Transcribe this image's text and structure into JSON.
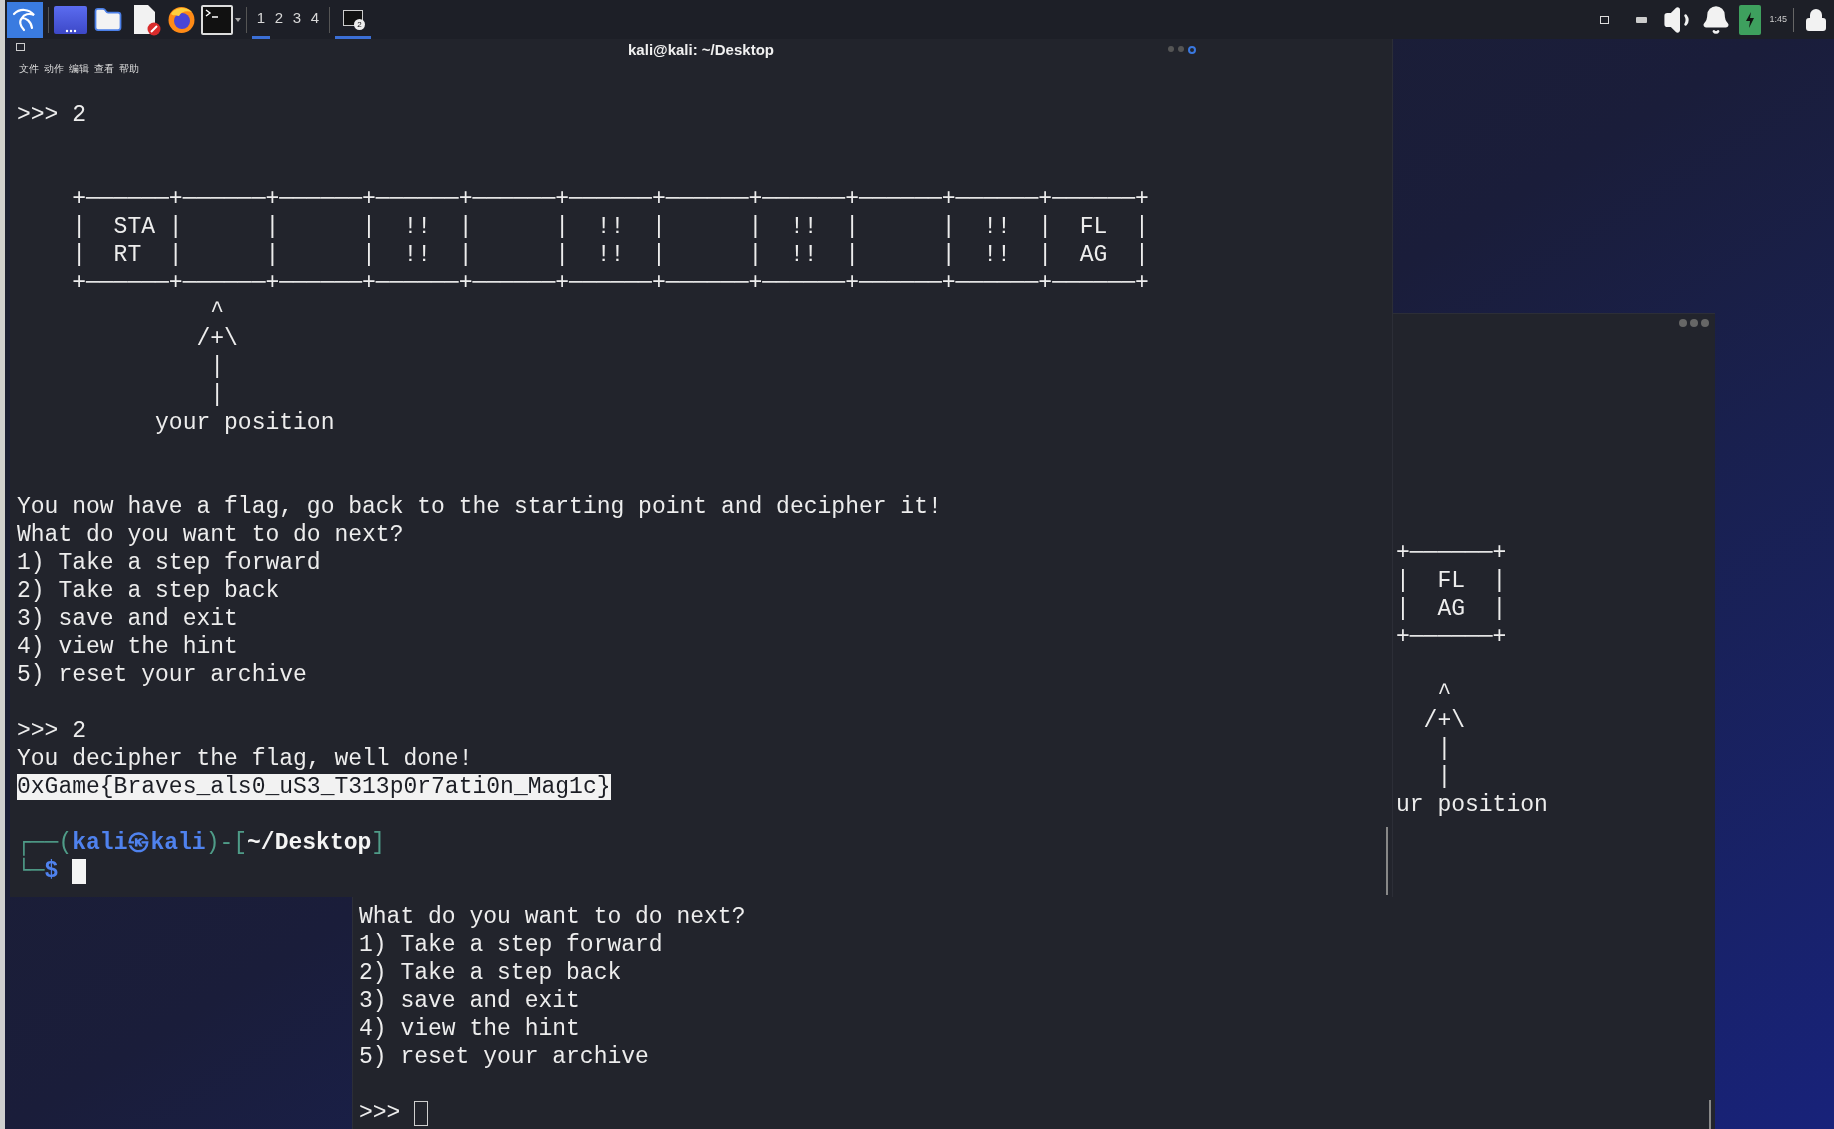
{
  "taskbar": {
    "workspaces": [
      {
        "label": "1",
        "selected": true
      },
      {
        "label": "2",
        "selected": false
      },
      {
        "label": "3",
        "selected": false
      },
      {
        "label": "4",
        "selected": false
      }
    ],
    "task_button": {
      "badge": "2",
      "active": true
    },
    "clock": "1:45"
  },
  "back_terminal": {
    "fragment_lines": [
      {
        "kind": "art",
        "text": "+──────+"
      },
      {
        "kind": "art",
        "text": "|  FL  |"
      },
      {
        "kind": "art",
        "text": "|  AG  |"
      },
      {
        "kind": "art",
        "text": "+──────+"
      },
      {
        "kind": "blank"
      },
      {
        "kind": "art",
        "text": "   ^"
      },
      {
        "kind": "art",
        "text": "  /+\\"
      },
      {
        "kind": "art",
        "text": "   |"
      },
      {
        "kind": "art",
        "text": "   |"
      },
      {
        "kind": "text",
        "text": "ur position"
      }
    ],
    "lines": [
      {
        "kind": "text",
        "text": "What do you want to do next?"
      },
      {
        "kind": "text",
        "text": "1) Take a step forward"
      },
      {
        "kind": "text",
        "text": "2) Take a step back"
      },
      {
        "kind": "text",
        "text": "3) save and exit"
      },
      {
        "kind": "text",
        "text": "4) view the hint"
      },
      {
        "kind": "text",
        "text": "5) reset your archive"
      },
      {
        "kind": "blank"
      }
    ],
    "prompt": ">>>",
    "cursor_focused": false
  },
  "front_terminal": {
    "title": "kali@kali: ~/Desktop",
    "menu": [
      "文件",
      "动作",
      "编辑",
      "查看",
      "帮助"
    ],
    "lines": [
      {
        "kind": "text",
        "text": ">>> 2"
      },
      {
        "kind": "blank"
      },
      {
        "kind": "blank"
      },
      {
        "kind": "art",
        "text": "    +──────+──────+──────+──────+──────+──────+──────+──────+──────+──────+──────+"
      },
      {
        "kind": "art",
        "text": "    |  STA |      |      |  !!  |      |  !!  |      |  !!  |      |  !!  |  FL  |"
      },
      {
        "kind": "art",
        "text": "    |  RT  |      |      |  !!  |      |  !!  |      |  !!  |      |  !!  |  AG  |"
      },
      {
        "kind": "art",
        "text": "    +──────+──────+──────+──────+──────+──────+──────+──────+──────+──────+──────+"
      },
      {
        "kind": "art",
        "text": "              ^"
      },
      {
        "kind": "art",
        "text": "             /+\\"
      },
      {
        "kind": "art",
        "text": "              |"
      },
      {
        "kind": "art",
        "text": "              |"
      },
      {
        "kind": "text",
        "text": "          your position"
      },
      {
        "kind": "blank"
      },
      {
        "kind": "blank"
      },
      {
        "kind": "text",
        "text": "You now have a flag, go back to the starting point and decipher it!"
      },
      {
        "kind": "text",
        "text": "What do you want to do next?"
      },
      {
        "kind": "text",
        "text": "1) Take a step forward"
      },
      {
        "kind": "text",
        "text": "2) Take a step back"
      },
      {
        "kind": "text",
        "text": "3) save and exit"
      },
      {
        "kind": "text",
        "text": "4) view the hint"
      },
      {
        "kind": "text",
        "text": "5) reset your archive"
      },
      {
        "kind": "blank"
      },
      {
        "kind": "text",
        "text": ">>> 2"
      },
      {
        "kind": "text",
        "text": "You decipher the flag, well done!"
      },
      {
        "kind": "selected",
        "text": "0xGame{Braves_als0_uS3_T313p0r7ati0n_Mag1c}"
      },
      {
        "kind": "blank"
      }
    ],
    "prompt": {
      "line1": [
        {
          "kind": "frame",
          "text": "┌──("
        },
        {
          "kind": "user",
          "text": "kali㉿kali"
        },
        {
          "kind": "frame",
          "text": ")-["
        },
        {
          "kind": "path",
          "text": "~/Desktop"
        },
        {
          "kind": "frame",
          "text": "]"
        }
      ],
      "line2": [
        {
          "kind": "frame",
          "text": "└─"
        },
        {
          "kind": "user",
          "text": "$"
        }
      ]
    },
    "cursor_focused": true
  }
}
